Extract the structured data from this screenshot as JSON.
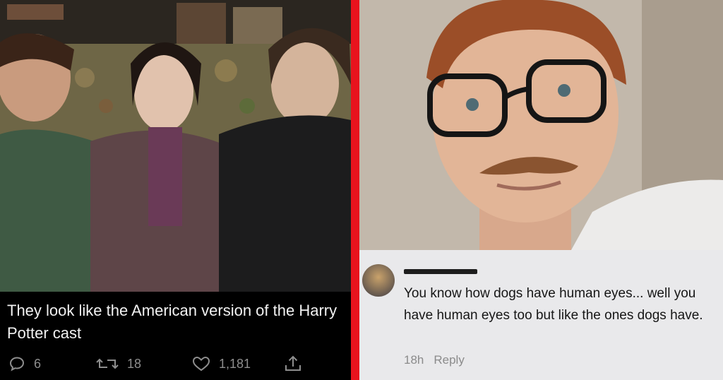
{
  "tweet": {
    "text": "They look like the American version of the Harry Potter cast",
    "replies": "6",
    "retweets": "18",
    "likes": "1,181",
    "icons": [
      "reply-icon",
      "retweet-icon",
      "like-icon",
      "share-icon"
    ]
  },
  "comment": {
    "text": "You know how dogs have human eyes... well you have human eyes too but like the ones dogs have.",
    "time": "18h",
    "reply_label": "Reply"
  },
  "colors": {
    "divider": "#e8131d",
    "tweet_bg": "#000000",
    "tweet_text": "#f2f2f2",
    "tweet_action": "#8e8e8e",
    "comment_bg": "#e9e9eb",
    "comment_text": "#161616",
    "comment_meta": "#8b8b8b"
  }
}
